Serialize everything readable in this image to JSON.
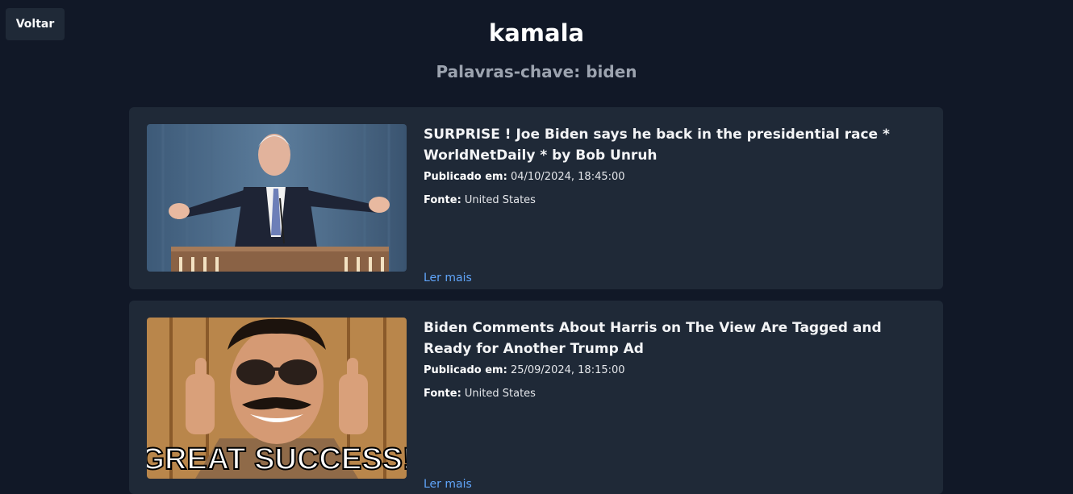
{
  "header": {
    "back_label": "Voltar",
    "title": "kamala",
    "keywords": "Palavras-chave: biden"
  },
  "articles": [
    {
      "title": "SURPRISE ! Joe Biden says he back in the presidential race * WorldNetDaily * by Bob Unruh",
      "published_label": "Publicado em:",
      "published_value": "04/10/2024, 18:45:00",
      "source_label": "Fonte:",
      "source_value": "United States",
      "read_more": "Ler mais",
      "image_icon": "biden-podium-photo"
    },
    {
      "title": "Biden Comments About Harris on The View Are Tagged and Ready for Another Trump Ad",
      "published_label": "Publicado em:",
      "published_value": "25/09/2024, 18:15:00",
      "source_label": "Fonte:",
      "source_value": "United States",
      "read_more": "Ler mais",
      "image_icon": "great-success-meme-photo",
      "image_caption": "GREAT SUCCESS!"
    }
  ],
  "colors": {
    "background": "#111827",
    "card": "#1f2937",
    "link": "#60a5fa",
    "muted": "#9ca3af"
  }
}
